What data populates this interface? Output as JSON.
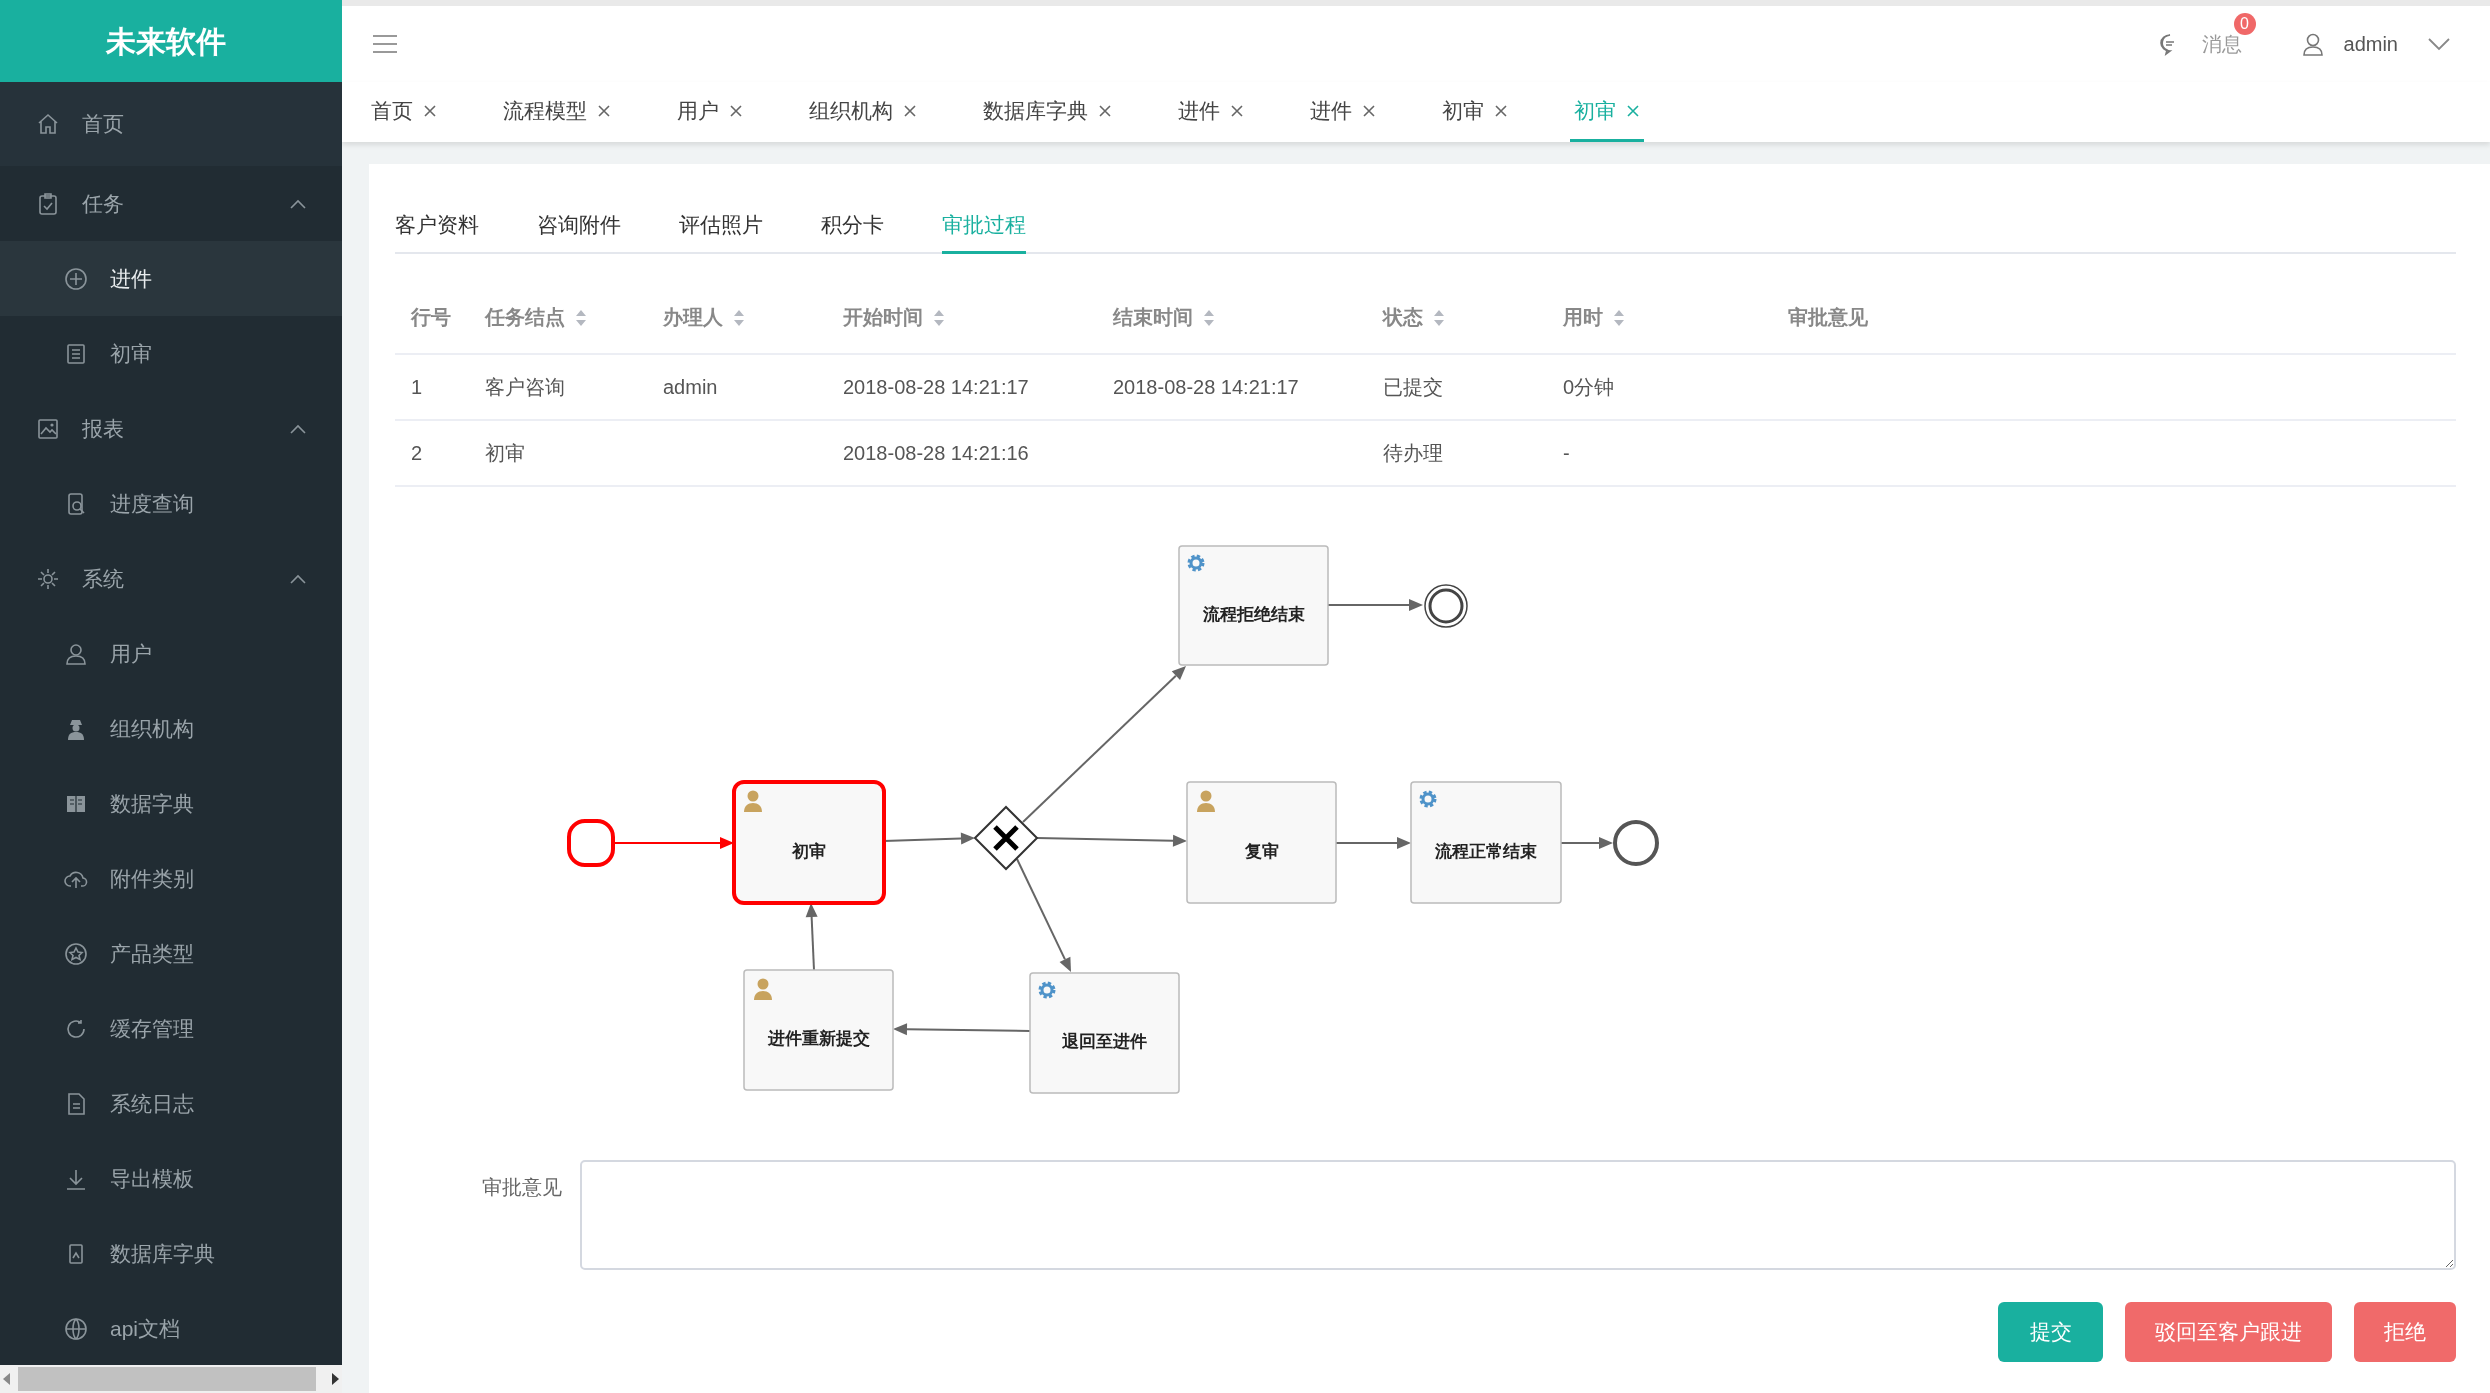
{
  "brand": "未来软件",
  "sidebar": {
    "items": [
      {
        "kind": "link",
        "label": "首页",
        "selected": false
      },
      {
        "kind": "group",
        "label": "任务",
        "expanded": true,
        "children": [
          {
            "label": "进件",
            "selected": true
          },
          {
            "label": "初审",
            "selected": false
          }
        ]
      },
      {
        "kind": "group",
        "label": "报表",
        "expanded": true,
        "children": [
          {
            "label": "进度查询",
            "selected": false
          }
        ]
      },
      {
        "kind": "group",
        "label": "系统",
        "expanded": true,
        "children": [
          {
            "label": "用户",
            "selected": false
          },
          {
            "label": "组织机构",
            "selected": false
          },
          {
            "label": "数据字典",
            "selected": false
          },
          {
            "label": "附件类别",
            "selected": false
          },
          {
            "label": "产品类型",
            "selected": false
          },
          {
            "label": "缓存管理",
            "selected": false
          },
          {
            "label": "系统日志",
            "selected": false
          },
          {
            "label": "导出模板",
            "selected": false
          },
          {
            "label": "数据库字典",
            "selected": false
          },
          {
            "label": "api文档",
            "selected": false
          }
        ]
      }
    ]
  },
  "header": {
    "messages_label": "消息",
    "messages_count": "0",
    "user": "admin"
  },
  "tabs": [
    {
      "label": "首页",
      "selected": false
    },
    {
      "label": "流程模型",
      "selected": false
    },
    {
      "label": "用户",
      "selected": false
    },
    {
      "label": "组织机构",
      "selected": false
    },
    {
      "label": "数据库字典",
      "selected": false
    },
    {
      "label": "进件",
      "selected": false
    },
    {
      "label": "进件",
      "selected": false
    },
    {
      "label": "初审",
      "selected": false
    },
    {
      "label": "初审",
      "selected": true
    }
  ],
  "subtabs": [
    {
      "label": "客户资料",
      "selected": false
    },
    {
      "label": "咨询附件",
      "selected": false
    },
    {
      "label": "评估照片",
      "selected": false
    },
    {
      "label": "积分卡",
      "selected": false
    },
    {
      "label": "审批过程",
      "selected": true
    }
  ],
  "table": {
    "columns": [
      {
        "label": "行号",
        "sortable": false
      },
      {
        "label": "任务结点",
        "sortable": true
      },
      {
        "label": "办理人",
        "sortable": true
      },
      {
        "label": "开始时间",
        "sortable": true
      },
      {
        "label": "结束时间",
        "sortable": true
      },
      {
        "label": "状态",
        "sortable": true
      },
      {
        "label": "用时",
        "sortable": true
      },
      {
        "label": "审批意见",
        "sortable": false
      }
    ],
    "rows": [
      [
        "1",
        "客户咨询",
        "admin",
        "2018-08-28 14:21:17",
        "2018-08-28 14:21:17",
        "已提交",
        "0分钟",
        ""
      ],
      [
        "2",
        "初审",
        "",
        "2018-08-28 14:21:16",
        "",
        "待办理",
        "-",
        ""
      ]
    ]
  },
  "diagram": {
    "nodes": [
      {
        "kind": "start",
        "highlighted": true
      },
      {
        "kind": "user_task",
        "label": "初审",
        "highlighted": true
      },
      {
        "kind": "gateway",
        "highlighted": false
      },
      {
        "kind": "service_task",
        "label": "流程拒绝结束",
        "highlighted": false
      },
      {
        "kind": "end",
        "highlighted": false
      },
      {
        "kind": "user_task",
        "label": "复审",
        "highlighted": false
      },
      {
        "kind": "service_task",
        "label": "流程正常结束",
        "highlighted": false
      },
      {
        "kind": "end",
        "highlighted": false
      },
      {
        "kind": "user_task",
        "label": "进件重新提交",
        "highlighted": false
      },
      {
        "kind": "service_task",
        "label": "退回至进件",
        "highlighted": false
      }
    ]
  },
  "form": {
    "label": "审批意见"
  },
  "buttons": [
    {
      "label": "提交",
      "kind": "primary"
    },
    {
      "label": "驳回至客户跟进",
      "kind": "danger"
    },
    {
      "label": "拒绝",
      "kind": "danger"
    }
  ]
}
